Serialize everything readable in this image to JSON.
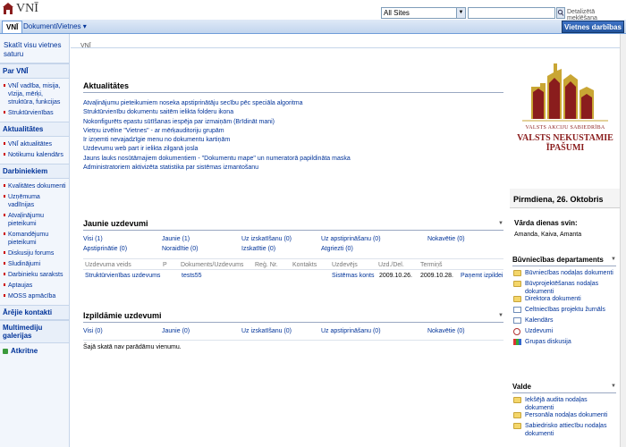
{
  "header": {
    "site_title": "VNĪ",
    "scope_value": "All Sites",
    "search_placeholder": "",
    "advanced_search_label": "Detalizētā meklēšana"
  },
  "nav": {
    "tabs": [
      {
        "label": "VNĪ"
      },
      {
        "label": "Dokumenti"
      },
      {
        "label": "Vietnes ▾"
      }
    ],
    "site_actions_label": "Vietnes darbības ▾"
  },
  "leftnav": {
    "view_all": "Skatīt visu vietnes saturu",
    "sections": [
      {
        "heading": "Par VNĪ",
        "items": [
          "VNĪ vadība, misija, vīzija, mērķi, struktūra, funkcijas",
          "Struktūrvienības"
        ]
      },
      {
        "heading": "Aktualitātes",
        "items": [
          "VNĪ aktualitātes",
          "Notikumu kalendārs"
        ]
      },
      {
        "heading": "Darbiniekiem",
        "items": [
          "Kvalitātes dokumenti",
          "Uzņēmuma vadlīnijas",
          "Atvaļinājumu pieteikumi",
          "Komandējumu pieteikumi",
          "Diskusiju forums",
          "Sludinājumi",
          "Darbinieku saraksts",
          "Aptaujas",
          "MOSS apmācība"
        ]
      }
    ],
    "extra_headings": [
      "Ārējie kontakti",
      "Multimediju galerijas"
    ],
    "recycle_label": "Atkritne"
  },
  "breadcrumb": "VNĪ",
  "announcements": {
    "title": "Aktualitātes",
    "items": [
      "Atvaļinājumu pieteikumiem noseka apstiprinātāju secību pēc speciāla algoritma",
      "Struktūrvienību dokumentu saitēm ielikta folderu ikona",
      "Nokonfigurēts epastu sūtīšanas iespēja par izmaiņām (Brīdināt mani)",
      "Vietņu izvēlne \"Vietnes\" - ar mērķauditoriju grupām",
      "Ir izņemti nevajadzīgie menu no dokumentu kartiņām",
      "Uzdevumu web part ir ielikta zilganā josla",
      "Jauns lauks nosūtāmajiem dokumentiem - \"Dokumentu mape\" un numeratorā papildināta maska",
      "Administratoriem aktivizēta statistika par sistēmas izmantošanu"
    ]
  },
  "new_tasks": {
    "title": "Jaunie uzdevumi",
    "filters_row1": [
      "Visi (1)",
      "Jaunie (1)",
      "Uz izskatīšanu (0)",
      "Uz apstiprināšanu (0)",
      "Nokavētie (0)"
    ],
    "filters_row2": [
      "Apstiprinātie (0)",
      "Noraidītie (0)",
      "Izskatītie (0)",
      "Atgriezti (0)"
    ],
    "columns": [
      "Uzdevuma veids",
      "P",
      "Dokuments/Uzdevums",
      "Reģ. Nr.",
      "Kontakts",
      "Uzdevējs",
      "Uzd./Del.",
      "Termiņš"
    ],
    "row": {
      "type": "Struktūrvienības uzdevums",
      "doc": "tests55",
      "assigner": "Sistēmas konts",
      "assigned": "2009.10.26.",
      "due": "2009.10.28.",
      "action": "Paņemt izpildei"
    }
  },
  "done_tasks": {
    "title": "Izpildāmie uzdevumi",
    "filters_row1": [
      "Visi (0)",
      "Jaunie (0)",
      "Uz izskatīšanu (0)",
      "Uz apstiprināšanu (0)",
      "Nokavētie (0)"
    ],
    "empty_message": "Šajā skatā nav parādāmu vienumu."
  },
  "brand": {
    "small_text": "VALSTS AKCIJU SABIEDRĪBA",
    "big_text": "VALSTS NEKUSTAMIE ĪPAŠUMI",
    "color": "#8a1d1d"
  },
  "right": {
    "date": "Pirmdiena, 26. Oktobris",
    "nameday_label": "Vārda dienas svin:",
    "nameday_value": "Amanda, Kaiva, Amanta",
    "departments_title": "Būvniecības departaments",
    "departments": [
      {
        "label": "Būvniecības nodaļas dokumenti",
        "icon": "folder-icon"
      },
      {
        "label": "Būvprojektēšanas nodaļas dokumenti",
        "icon": "folder-icon"
      },
      {
        "label": "Direktora dokumenti",
        "icon": "folder-icon"
      },
      {
        "label": "Celtniecības projektu žurnāls",
        "icon": "calendar-icon"
      },
      {
        "label": "Kalendārs",
        "icon": "calendar-icon"
      },
      {
        "label": "Uzdevumi",
        "icon": "clock-icon"
      },
      {
        "label": "Grupas diskusija",
        "icon": "discussion-icon"
      }
    ],
    "board_title": "Valde",
    "board": [
      {
        "label": "Iekšējā audita nodaļas dokumenti",
        "icon": "folder-icon"
      },
      {
        "label": "Personāla nodaļas dokumenti",
        "icon": "folder-icon"
      },
      {
        "label": "Sabiedrisko attiecību nodaļas dokumenti",
        "icon": "folder-icon"
      }
    ]
  }
}
